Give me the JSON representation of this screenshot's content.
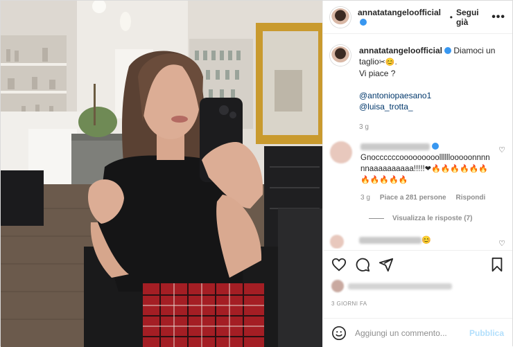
{
  "post": {
    "username": "annatatangeloofficial",
    "follow_label": "Segui già",
    "more_label": "•••"
  },
  "caption": {
    "username": "annatatangeloofficial",
    "text_line1": "Diamoci un",
    "text_line2": "taglio",
    "emoji_line2": "✂😊.",
    "text_line3": "Vi piace ?",
    "mention1": "@antoniopaesano1",
    "mention2": "@luisa_trotta_",
    "time": "3 g"
  },
  "comment": {
    "text": "Gnoccccccooooooooollllllooooonnnnnnaaaaaaaaaa!!!!!",
    "emojis": "❤🔥🔥🔥🔥🔥🔥🔥🔥🔥🔥🔥",
    "time": "3 g",
    "likes": "Piace a 281 persone",
    "reply": "Rispondi",
    "view_replies": "Visualizza le risposte (7)"
  },
  "comment2": {
    "emoji": "😊"
  },
  "footer": {
    "date": "3 GIORNI FA",
    "add_placeholder": "Aggiungi un commento...",
    "publish": "Pubblica"
  },
  "colors": {
    "accent": "#3897f0",
    "publish_disabled": "#b2dffc",
    "text": "#262626",
    "muted": "#8e8e8e"
  }
}
